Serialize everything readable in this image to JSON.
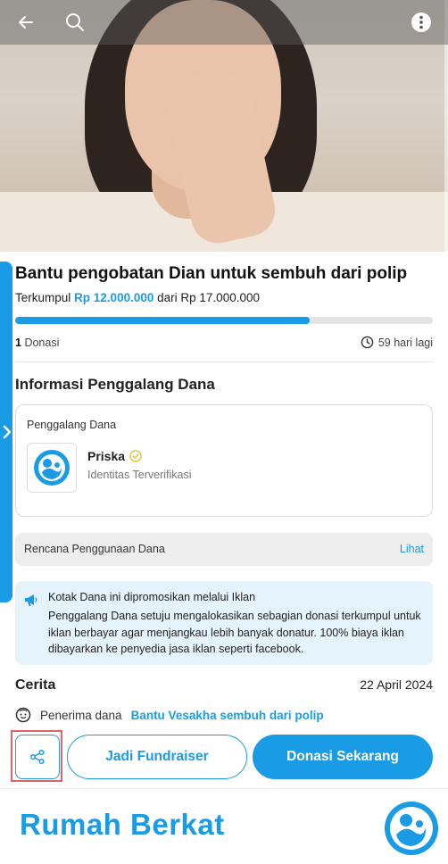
{
  "header": {
    "back_icon": "arrow-left-icon",
    "search_icon": "search-icon",
    "menu_icon": "more-vertical-icon"
  },
  "campaign": {
    "title": "Bantu pengobatan Dian untuk sembuh dari polip",
    "raised_prefix": "Terkumpul",
    "raised_amount": "Rp 12.000.000",
    "raised_connector": "dari",
    "target_amount": "Rp 17.000.000",
    "progress_fraction": 0.7059,
    "donation_count": "1",
    "donation_label": "Donasi",
    "days_left": "59 hari lagi"
  },
  "fundraiser_info": {
    "section_title": "Informasi Penggalang Dana",
    "box_label": "Penggalang Dana",
    "name": "Priska",
    "verified_text": "Identitas Terverifikasi"
  },
  "fund_plan": {
    "label": "Rencana Penggunaan Dana",
    "link": "Lihat"
  },
  "ad_notice": {
    "heading": "Kotak Dana ini dipromosikan melalui Iklan",
    "body": "Penggalang Dana setuju mengalokasikan sebagian donasi terkumpul untuk iklan berbayar agar menjangkau lebih banyak donatur. 100% biaya iklan dibayarkan ke penyedia jasa iklan seperti facebook."
  },
  "story": {
    "title": "Cerita",
    "date": "22 April 2024",
    "recipient_label": "Penerima dana",
    "recipient_link": "Bantu Vesakha sembuh dari polip"
  },
  "actions": {
    "share_icon": "share-icon",
    "fundraiser_label": "Jadi Fundraiser",
    "donate_label": "Donasi Sekarang"
  },
  "footer": {
    "brand": "Rumah Berkat"
  },
  "colors": {
    "accent": "#1a9be6",
    "highlight": "#e26363",
    "ad_bg": "#e4f3fc"
  }
}
